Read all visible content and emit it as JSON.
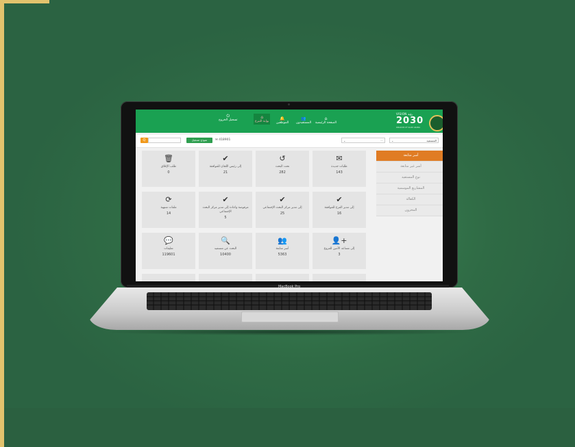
{
  "brand_label": "MacBook Pro",
  "colors": {
    "background": "#2f6b45",
    "topbar": "#1aa152",
    "accent_orange": "#e07c24",
    "button_green": "#2e9e4f"
  },
  "header": {
    "vision_label": "VISION رؤية",
    "vision_year": "2030",
    "nav": [
      {
        "label": "الصفحة الرئيسية",
        "icon": "home-icon"
      },
      {
        "label": "المستفيدون",
        "icon": "users-icon"
      },
      {
        "label": "الموظفين",
        "icon": "bell-icon"
      },
      {
        "label": "بوابة التبرع",
        "icon": "donate-icon"
      },
      {
        "label": "تسجيل الخروج",
        "icon": "power-icon"
      }
    ]
  },
  "filterbar": {
    "search_button": "Q",
    "register_button": "نموذج تسجيل",
    "count_label": "✉ 418901",
    "select_beneficiary": "المستفيد",
    "select_second": "—"
  },
  "side_menu": [
    "أسر متابعة",
    "أسر غير متابعة",
    "نوع المستفيد",
    "المشاريع الموسمية",
    "الكفالة",
    "المخزون"
  ],
  "tiles": [
    {
      "icon": "🗑",
      "label": "طلب الإغلاق",
      "value": "0"
    },
    {
      "icon": "✔",
      "label": "إلى رئيس اللجان للموافقة",
      "value": "21"
    },
    {
      "icon": "↺",
      "label": "تحت البحث",
      "value": "282"
    },
    {
      "icon": "✉",
      "label": "طلبات جديدة",
      "value": "143"
    },
    {
      "icon": "⟳",
      "label": "ملفات منتهية",
      "value": "14"
    },
    {
      "icon": "✔",
      "label": "مرفوضة واعادة إلى مدير مركز البحث الإجتماعي",
      "value": "5"
    },
    {
      "icon": "✔",
      "label": "إلى مدير مركز البحث الإجتماعي",
      "value": "25"
    },
    {
      "icon": "✔",
      "label": "إلى مدير الفرع للموافقة",
      "value": "16"
    },
    {
      "icon": "💬",
      "label": "تعليقات",
      "value": "119601"
    },
    {
      "icon": "🔍",
      "label": "البحث عن مستفيد",
      "value": "10400"
    },
    {
      "icon": "👥",
      "label": "أسر متابعة",
      "value": "5363"
    },
    {
      "icon": "👤+",
      "label": "إلى مساعد الأمين للفروع",
      "value": "3"
    }
  ]
}
